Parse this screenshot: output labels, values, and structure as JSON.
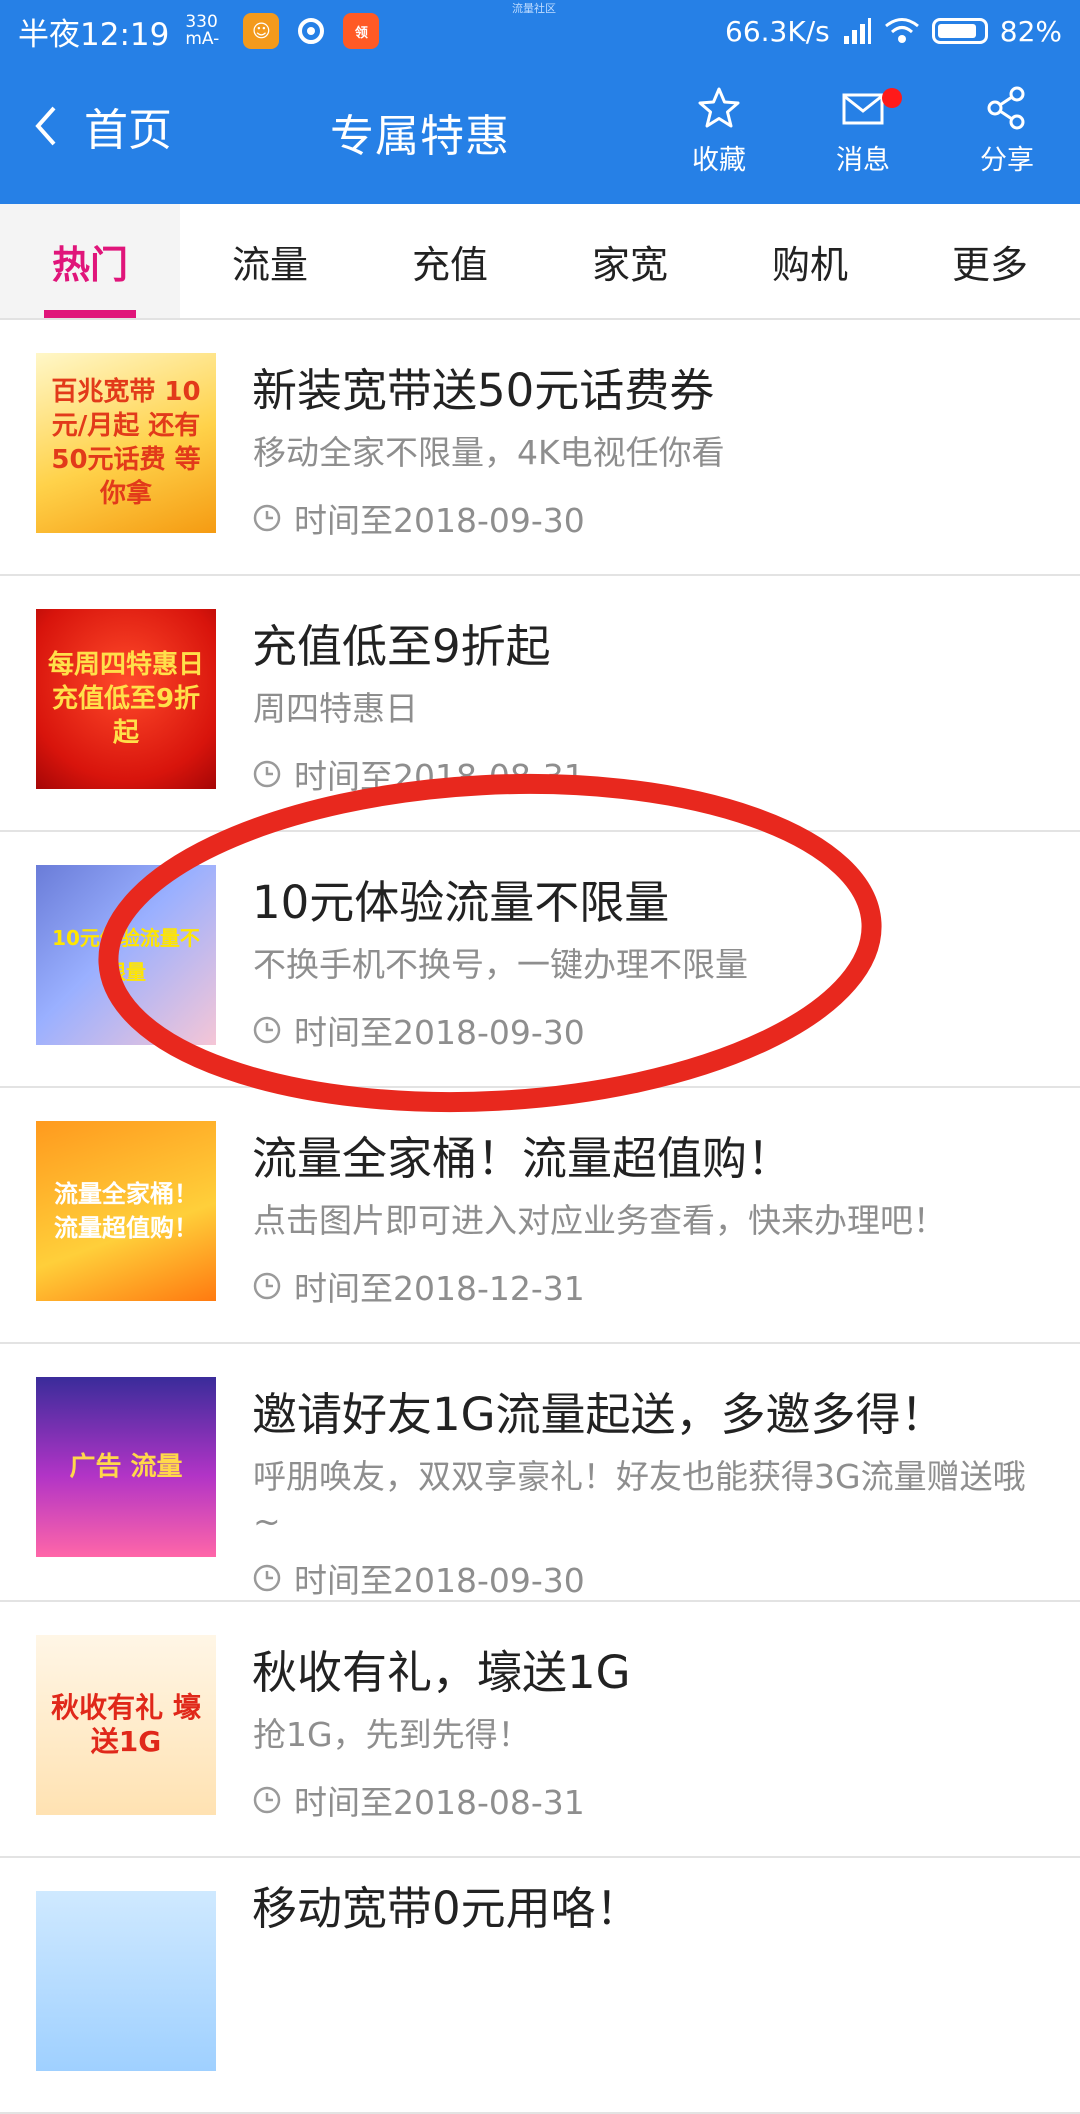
{
  "status_bar": {
    "time": "半夜12:19",
    "carrier_top": "330",
    "carrier_bottom": "mA-",
    "center_text": "流量社区",
    "speed": "66.3K/s",
    "battery": "82%"
  },
  "header": {
    "back_label": "首页",
    "title": "专属特惠",
    "actions": [
      {
        "label": "收藏",
        "icon": "star-icon"
      },
      {
        "label": "消息",
        "icon": "mail-icon"
      },
      {
        "label": "分享",
        "icon": "share-icon"
      }
    ]
  },
  "tabs": [
    "热门",
    "流量",
    "充值",
    "家宽",
    "购机",
    "更多"
  ],
  "active_tab": "热门",
  "offers": [
    {
      "title": "新装宽带送50元话费券",
      "subtitle": "移动全家不限量，4K电视任你看",
      "time": "时间至2018-09-30",
      "thumb_text": "百兆宽带 10元/月起 还有50元话费 等你拿"
    },
    {
      "title": "充值低至9折起",
      "subtitle": "周四特惠日",
      "time": "时间至2018-08-31",
      "thumb_text": "每周四特惠日 充值低至9折起"
    },
    {
      "title": "10元体验流量不限量",
      "subtitle": "不换手机不换号，一键办理不限量",
      "time": "时间至2018-09-30",
      "thumb_text": "10元体验流量不限量"
    },
    {
      "title": "流量全家桶！流量超值购！",
      "subtitle": "点击图片即可进入对应业务查看，快来办理吧！",
      "time": "时间至2018-12-31",
      "thumb_text": "流量全家桶！ 流量超值购！"
    },
    {
      "title": "邀请好友1G流量起送，多邀多得！",
      "subtitle": "呼朋唤友，双双享豪礼！好友也能获得3G流量赠送哦~",
      "time": "时间至2018-09-30",
      "thumb_text": "广告 流量"
    },
    {
      "title": "秋收有礼，壕送1G",
      "subtitle": "抢1G，先到先得！",
      "time": "时间至2018-08-31",
      "thumb_text": "秋收有礼 壕送1G"
    },
    {
      "title": "移动宽带0元用咯！",
      "subtitle": "",
      "time": "",
      "thumb_text": ""
    }
  ],
  "colors": {
    "header_blue": "#2680e6",
    "accent_pink": "#e0157a",
    "annotation_red": "#e8281e"
  }
}
